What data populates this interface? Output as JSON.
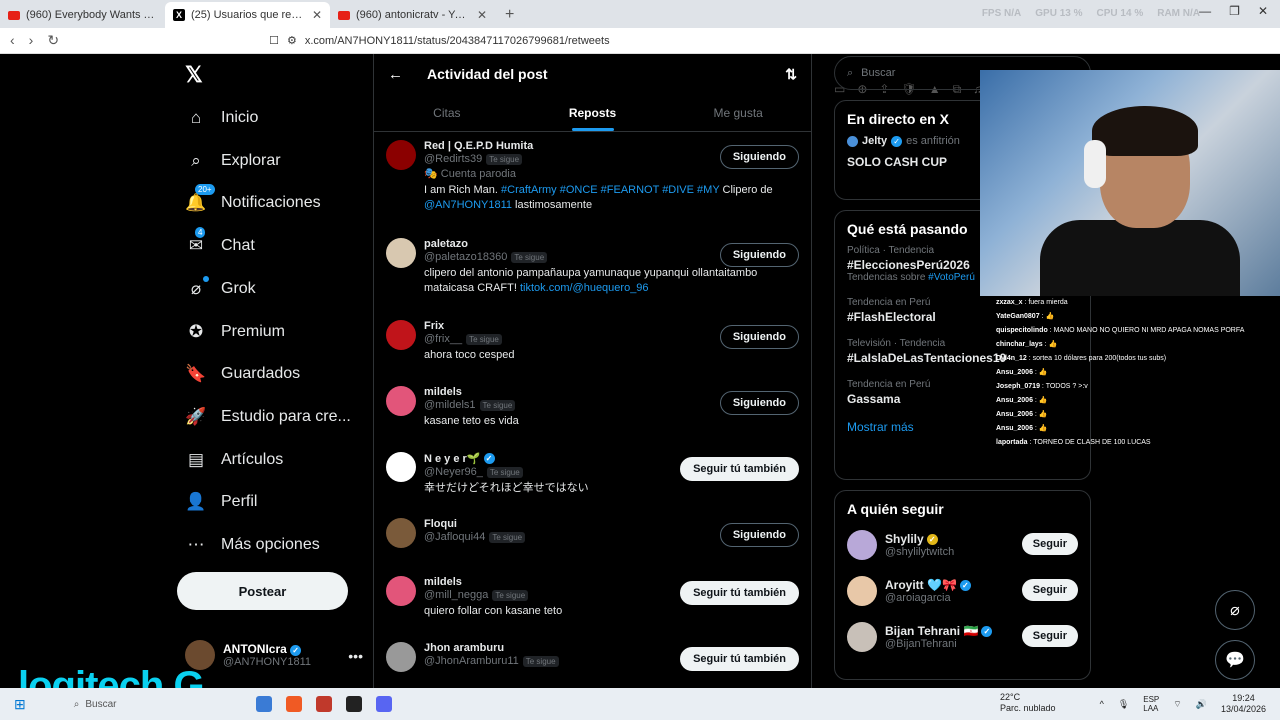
{
  "browser": {
    "tabs": [
      {
        "title": "(960) Everybody Wants To Rule Th",
        "kind": "youtube"
      },
      {
        "title": "(25) Usuarios que repostearon e",
        "kind": "x"
      },
      {
        "title": "(960) antonicratv - YouTube",
        "kind": "youtube"
      }
    ],
    "url": "x.com/AN7HONY1811/status/2043847117026799681/retweets",
    "perf": [
      "FPS N/A",
      "GPU 13 %",
      "CPU 14 %",
      "RAM N/A"
    ]
  },
  "nav": {
    "items": [
      {
        "label": "Inicio",
        "icon": "home-icon"
      },
      {
        "label": "Explorar",
        "icon": "search-icon"
      },
      {
        "label": "Notificaciones",
        "icon": "bell-icon",
        "badge": "20+"
      },
      {
        "label": "Chat",
        "icon": "chat-icon",
        "badge": "4"
      },
      {
        "label": "Grok",
        "icon": "grok-icon",
        "dot": true
      },
      {
        "label": "Premium",
        "icon": "premium-icon"
      },
      {
        "label": "Guardados",
        "icon": "bookmark-icon"
      },
      {
        "label": "Estudio para cre...",
        "icon": "rocket-icon"
      },
      {
        "label": "Artículos",
        "icon": "article-icon"
      },
      {
        "label": "Perfil",
        "icon": "person-icon"
      },
      {
        "label": "Más opciones",
        "icon": "more-icon"
      }
    ],
    "post_label": "Postear",
    "profile": {
      "name": "ANTONIcra",
      "handle": "@AN7HONY1811"
    }
  },
  "main": {
    "title": "Actividad del post",
    "tabs": [
      "Citas",
      "Reposts",
      "Me gusta"
    ],
    "users": [
      {
        "name": "Red | Q.E.P.D Humita",
        "handle": "@Redirts39",
        "follows": "Te sigue",
        "parody": "Cuenta parodia",
        "bio_parts": [
          {
            "t": "I am Rich Man. ",
            "l": false
          },
          {
            "t": "#CraftArmy #ONCE #FEARNOT #DIVE #MY",
            "l": true
          },
          {
            "t": " Clipero de ",
            "l": false
          },
          {
            "t": "@AN7HONY1811",
            "l": true
          },
          {
            "t": " lastimosamente",
            "l": false
          }
        ],
        "button": "Siguiendo",
        "color": "#8b0000"
      },
      {
        "name": "paletazo",
        "handle": "@paletazo18360",
        "follows": "Te sigue",
        "bio_parts": [
          {
            "t": "clipero del antonio pampañaupa yamunaque yupanqui ollantaitambo mataicasa CRAFT! ",
            "l": false
          },
          {
            "t": "tiktok.com/@huequero_96",
            "l": true
          }
        ],
        "button": "Siguiendo",
        "color": "#d8c8b0"
      },
      {
        "name": "Frix",
        "handle": "@frix__",
        "follows": "Te sigue",
        "bio_parts": [
          {
            "t": "ahora toco cesped",
            "l": false
          }
        ],
        "button": "Siguiendo",
        "color": "#c0141a"
      },
      {
        "name": "mildels",
        "handle": "@mildels1",
        "follows": "Te sigue",
        "bio_parts": [
          {
            "t": "kasane teto es vida",
            "l": false
          }
        ],
        "button": "Siguiendo",
        "color": "#e2557a"
      },
      {
        "name": "N e y e r🌱",
        "handle": "@Neyer96_",
        "follows": "Te sigue",
        "verified": true,
        "bio_parts": [
          {
            "t": "幸せだけどそれほど幸せではない",
            "l": false
          }
        ],
        "button": "Seguir tú también",
        "color": "#ffffff"
      },
      {
        "name": "Floqui",
        "handle": "@Jafloqui44",
        "follows": "Te sigue",
        "bio_parts": [],
        "button": "Siguiendo",
        "color": "#7a5a3a"
      },
      {
        "name": "mildels",
        "handle": "@mill_negga",
        "follows": "Te sigue",
        "bio_parts": [
          {
            "t": "quiero follar con kasane teto",
            "l": false
          }
        ],
        "button": "Seguir tú también",
        "color": "#e2557a"
      },
      {
        "name": "Jhon aramburu",
        "handle": "@JhonAramburu11",
        "follows": "Te sigue",
        "bio_parts": [],
        "button": "Seguir tú también",
        "color": "#999999"
      }
    ]
  },
  "right": {
    "search_placeholder": "Buscar",
    "live": {
      "title": "En directo en X",
      "host_name": "Jelty",
      "host_role": "es anfitrión",
      "space": "SOLO CASH CUP"
    },
    "trends": {
      "title": "Qué está pasando",
      "items": [
        {
          "meta": "Política · Tendencia",
          "name": "#EleccionesPerú2026",
          "extra": "Tendencias sobre",
          "extra_link": "#VotoPerú"
        },
        {
          "meta": "Tendencia en Perú",
          "name": "#FlashElectoral"
        },
        {
          "meta": "Televisión · Tendencia",
          "name": "#LaIslaDeLasTentaciones10"
        },
        {
          "meta": "Tendencia en Perú",
          "name": "Gassama"
        }
      ],
      "more": "Mostrar más"
    },
    "who": {
      "title": "A quién seguir",
      "items": [
        {
          "name": "Shylily",
          "handle": "@shylilytwitch",
          "color": "#b8a8d8",
          "verified": "gold"
        },
        {
          "name": "Aroyitt 🩵🎀",
          "handle": "@aroiagarcia",
          "color": "#e8c8a8",
          "verified": "blue"
        },
        {
          "name": "Bijan Tehrani 🇮🇷",
          "handle": "@BijanTehrani",
          "color": "#c8c0b8",
          "verified": "blue"
        }
      ],
      "button": "Seguir"
    }
  },
  "chat": [
    {
      "u": "zxzax_x",
      "m": "fuera mierda",
      "c": "#ffffff"
    },
    {
      "u": "YateGan0807",
      "m": "👍",
      "c": "#e0c040"
    },
    {
      "u": "quispecitolindo",
      "m": "MANO MANO NO QUIERO NI MRD APAGA NOMAS PORFA",
      "c": "#e07040"
    },
    {
      "u": "chinchar_lays",
      "m": "👍",
      "c": "#c080e0"
    },
    {
      "u": "Dyl4n_12",
      "m": "sortea 10 dólares para 200(todos tus subs)",
      "c": "#60a0ff"
    },
    {
      "u": "Ansu_2006",
      "m": "👍",
      "c": "#60a0ff"
    },
    {
      "u": "Joseph_0719",
      "m": "TODOS ? >:v",
      "c": "#40e060"
    },
    {
      "u": "Ansu_2006",
      "m": "👍",
      "c": "#60a0ff"
    },
    {
      "u": "Ansu_2006",
      "m": "👍",
      "c": "#60a0ff"
    },
    {
      "u": "Ansu_2006",
      "m": "👍",
      "c": "#60a0ff"
    },
    {
      "u": "laportada",
      "m": "TORNEO DE CLASH DE 100 LUCAS",
      "c": "#60a0ff"
    }
  ],
  "overlay": {
    "logo": "logitech G"
  },
  "taskbar": {
    "search": "Buscar",
    "temp": "22°C",
    "weather": "Parc. nublado",
    "lang": "ESP\nLAA",
    "time": "19:24",
    "date": "13/04/2026"
  }
}
